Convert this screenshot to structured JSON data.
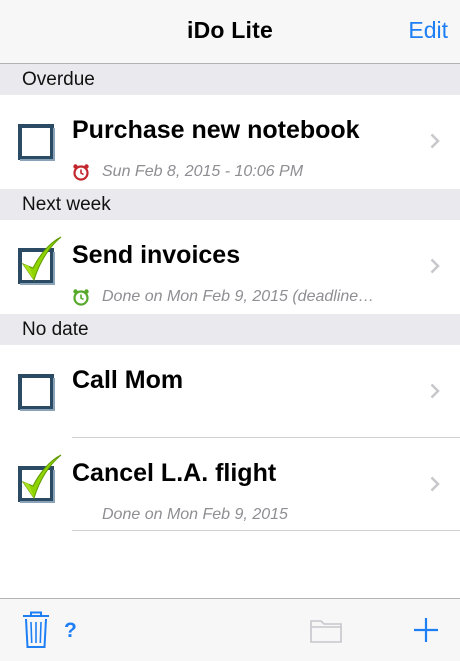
{
  "nav": {
    "title": "iDo Lite",
    "edit_label": "Edit"
  },
  "sections": [
    {
      "header": "Overdue",
      "items": [
        {
          "title": "Purchase new notebook",
          "subtitle": "Sun Feb 8, 2015 - 10:06 PM",
          "checked": false,
          "alarm_icon": "red-alarm-clock-icon"
        }
      ]
    },
    {
      "header": "Next week",
      "items": [
        {
          "title": "Send invoices",
          "subtitle": "Done on Mon Feb 9, 2015 (deadline…",
          "checked": true,
          "alarm_icon": "green-alarm-clock-icon"
        }
      ]
    },
    {
      "header": "No date",
      "items": [
        {
          "title": "Call Mom",
          "subtitle": "",
          "checked": false
        },
        {
          "title": "Cancel L.A. flight",
          "subtitle": "Done on Mon Feb 9, 2015",
          "checked": true
        }
      ]
    }
  ],
  "toolbar": {
    "help_label": "?",
    "icons": [
      "trash-icon",
      "help-icon",
      "folder-icon",
      "add-icon"
    ]
  },
  "colors": {
    "accent": "#1e7ff5",
    "check_green": "#8fd400",
    "section_bg": "#e9e9ee",
    "subtitle_gray": "#8e8e93"
  }
}
